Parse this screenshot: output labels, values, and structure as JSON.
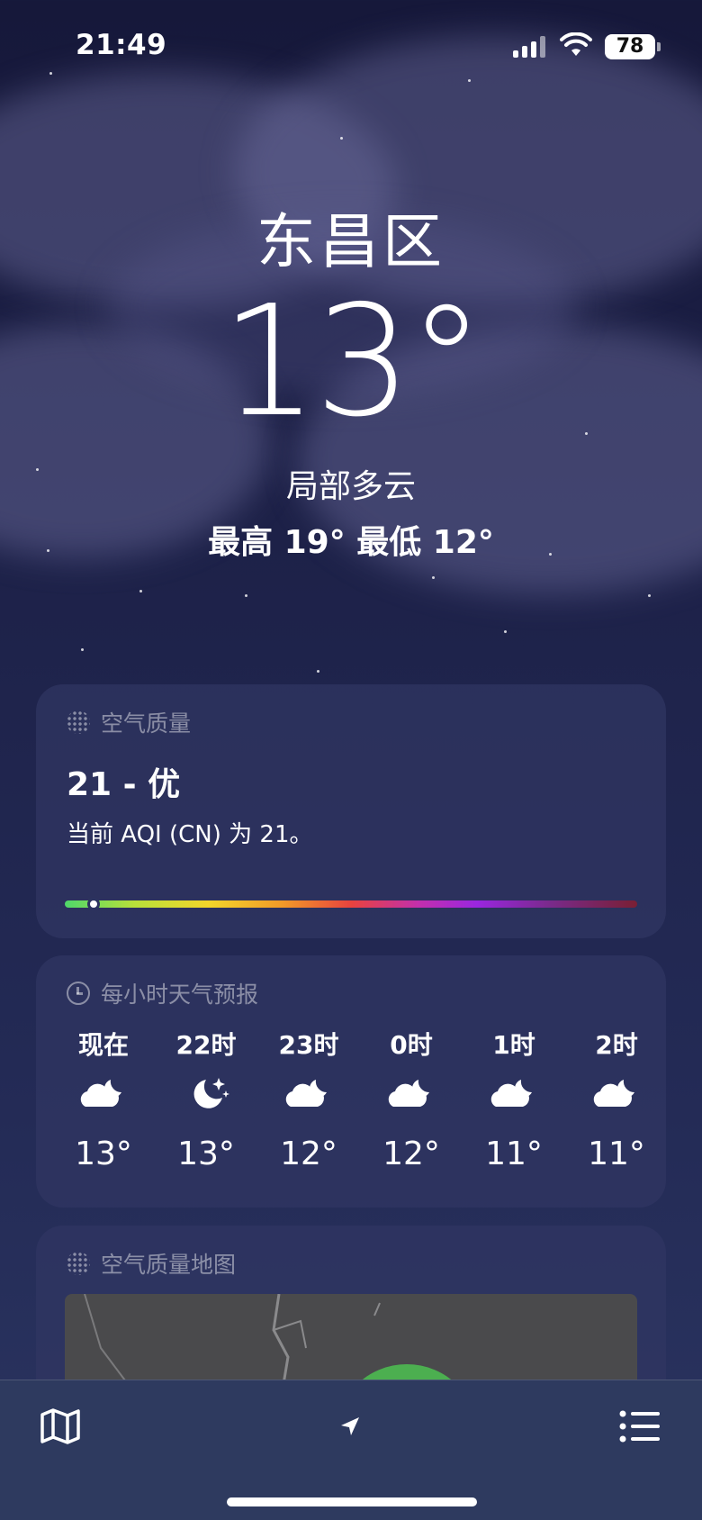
{
  "status_bar": {
    "time": "21:49",
    "battery": "78"
  },
  "weather": {
    "city": "东昌区",
    "temperature": "13°",
    "condition": "局部多云",
    "high_low": "最高 19°  最低 12°"
  },
  "air_quality": {
    "title": "空气质量",
    "value": "21 - 优",
    "description": "当前 AQI (CN) 为 21。",
    "level_fraction": 0.05
  },
  "hourly": {
    "title": "每小时天气预报",
    "items": [
      {
        "label": "现在",
        "icon": "partly-cloudy-night-icon",
        "temp": "13°"
      },
      {
        "label": "22时",
        "icon": "clear-night-icon",
        "temp": "13°"
      },
      {
        "label": "23时",
        "icon": "partly-cloudy-night-icon",
        "temp": "12°"
      },
      {
        "label": "0时",
        "icon": "partly-cloudy-night-icon",
        "temp": "12°"
      },
      {
        "label": "1时",
        "icon": "partly-cloudy-night-icon",
        "temp": "11°"
      },
      {
        "label": "2时",
        "icon": "partly-cloudy-night-icon",
        "temp": "11°"
      }
    ]
  },
  "air_quality_map": {
    "title": "空气质量地图"
  },
  "toolbar": {
    "map_icon": "map-icon",
    "location_icon": "location-arrow-icon",
    "list_icon": "list-icon"
  }
}
